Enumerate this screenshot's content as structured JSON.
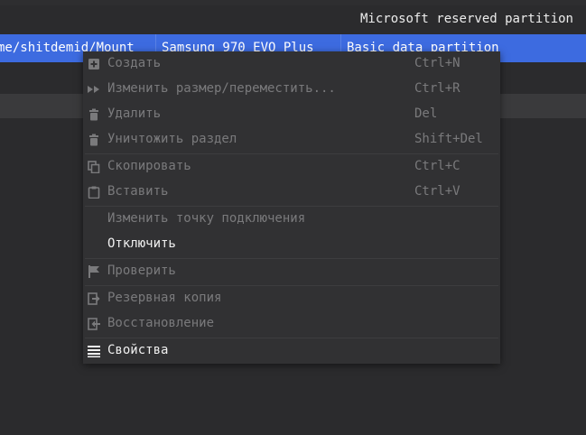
{
  "table": {
    "reserved_row": {
      "type": "Microsoft reserved partition"
    },
    "selected_row": {
      "mount": "me/shitdemid/Mount",
      "disk": "Samsung 970 EVO Plus",
      "type": "Basic data partition"
    }
  },
  "context_menu": {
    "items": [
      {
        "icon": "plus-box-icon",
        "label": "Создать",
        "shortcut": "Ctrl+N",
        "enabled": false
      },
      {
        "icon": "fast-forward-icon",
        "label": "Изменить размер/переместить...",
        "shortcut": "Ctrl+R",
        "enabled": false
      },
      {
        "icon": "trash-icon",
        "label": "Удалить",
        "shortcut": "Del",
        "enabled": false
      },
      {
        "icon": "trash-icon",
        "label": "Уничтожить раздел",
        "shortcut": "Shift+Del",
        "enabled": false
      },
      {
        "icon": "copy-icon",
        "label": "Скопировать",
        "shortcut": "Ctrl+C",
        "enabled": false
      },
      {
        "icon": "paste-icon",
        "label": "Вставить",
        "shortcut": "Ctrl+V",
        "enabled": false
      },
      {
        "icon": "",
        "label": "Изменить точку подключения",
        "shortcut": "",
        "enabled": false
      },
      {
        "icon": "",
        "label": "Отключить",
        "shortcut": "",
        "enabled": true
      },
      {
        "icon": "flag-icon",
        "label": "Проверить",
        "shortcut": "",
        "enabled": false
      },
      {
        "icon": "export-icon",
        "label": "Резервная копия",
        "shortcut": "",
        "enabled": false
      },
      {
        "icon": "import-icon",
        "label": "Восстановление",
        "shortcut": "",
        "enabled": false
      },
      {
        "icon": "list-icon",
        "label": "Свойства",
        "shortcut": "",
        "enabled": true
      }
    ]
  },
  "colors": {
    "selection": "#3d6be0",
    "background": "#2b2b2d",
    "menu_background": "#313133",
    "disabled_text": "#7a7a7c"
  }
}
